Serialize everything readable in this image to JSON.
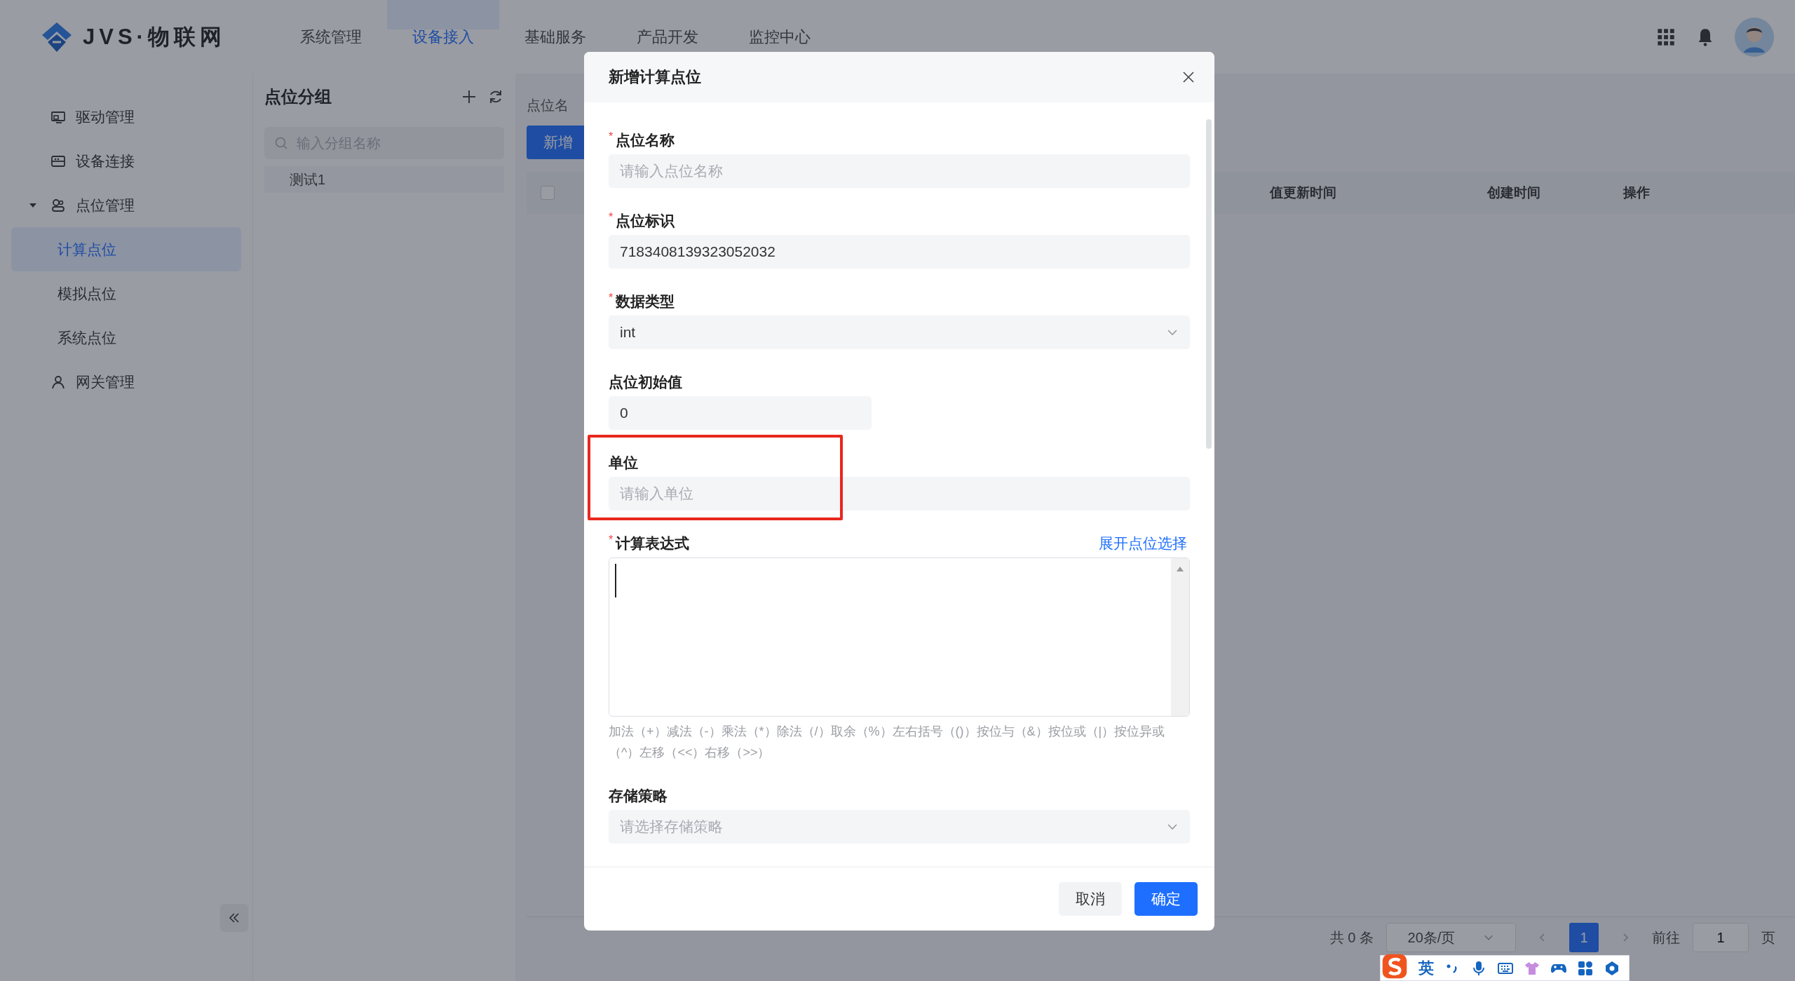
{
  "header": {
    "logo": "JVS·物联网",
    "nav": [
      {
        "label": "系统管理",
        "selected": false
      },
      {
        "label": "设备接入",
        "selected": true
      },
      {
        "label": "基础服务",
        "selected": false
      },
      {
        "label": "产品开发",
        "selected": false
      },
      {
        "label": "监控中心",
        "selected": false
      }
    ]
  },
  "sidebar": {
    "items": [
      {
        "label": "驱动管理",
        "selected": false
      },
      {
        "label": "设备连接",
        "selected": false
      },
      {
        "label": "点位管理",
        "selected": false,
        "expanded": true,
        "children": [
          {
            "label": "计算点位",
            "selected": true
          },
          {
            "label": "模拟点位",
            "selected": false
          },
          {
            "label": "系统点位",
            "selected": false
          }
        ]
      },
      {
        "label": "网关管理",
        "selected": false
      }
    ]
  },
  "group_panel": {
    "title": "点位分组",
    "search": {
      "placeholder": "输入分组名称"
    },
    "groups": [
      {
        "label": "测试1",
        "selected": false
      }
    ]
  },
  "main": {
    "filter_label": "点位名",
    "add_button": "新增",
    "table": {
      "select_all": {
        "checked": false
      },
      "columns": [
        "值更新时间",
        "创建时间",
        "操作"
      ]
    },
    "pagination": {
      "total": "共 0 条",
      "page_size": "20条/页",
      "pages": [
        {
          "label": "1",
          "selected": true
        }
      ],
      "goto_label": "前往",
      "goto_value": "1",
      "page_suffix": "页"
    }
  },
  "dialog": {
    "title": "新增计算点位",
    "fields": [
      {
        "kind": "input",
        "label": "点位名称",
        "required_mark": "*",
        "placeholder": "请输入点位名称"
      },
      {
        "kind": "input",
        "label": "点位标识",
        "required_mark": "*",
        "value": "7183408139323052032"
      },
      {
        "kind": "select",
        "label": "数据类型",
        "required_mark": "*",
        "value": "int"
      },
      {
        "kind": "short-input",
        "label": "点位初始值",
        "value": "0"
      },
      {
        "kind": "input",
        "label": "单位",
        "placeholder": "请输入单位",
        "highlighted": true
      },
      {
        "kind": "textarea",
        "label": "计算表达式",
        "required_mark": "*",
        "link": "展开点位选择",
        "hint": "加法（+）减法（-）乘法（*）除法（/）取余（%）左右括号（()）按位与（&）按位或（|）按位异或（^）左移（<<）右移（>>）"
      },
      {
        "kind": "select",
        "label": "存储策略",
        "placeholder": "请选择存储策略"
      }
    ],
    "buttons": [
      {
        "label": "取消",
        "kind": "default"
      },
      {
        "label": "确定",
        "kind": "primary"
      }
    ]
  },
  "ime_toolbar": {
    "mode": "英"
  }
}
